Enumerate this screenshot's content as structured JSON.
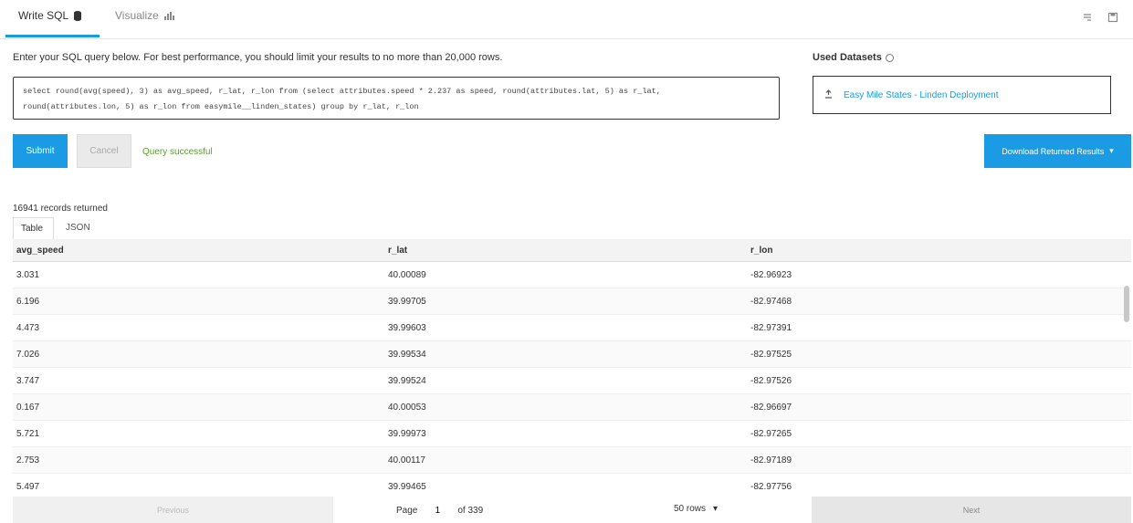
{
  "tabs": {
    "sql": "Write SQL",
    "visualize": "Visualize"
  },
  "instruction": "Enter your SQL query below. For best performance, you should limit your results to no more than 20,000 rows.",
  "sql": {
    "line1": "select round(avg(speed), 3) as avg_speed, r_lat, r_lon from (select attributes.speed * 2.237 as speed, round(attributes.lat, 5) as r_lat,",
    "line2": "round(attributes.lon, 5) as r_lon from easymile__linden_states) group by r_lat, r_lon"
  },
  "used_datasets": {
    "label": "Used Datasets",
    "items": [
      "Easy Mile States - Linden Deployment"
    ]
  },
  "buttons": {
    "submit": "Submit",
    "cancel": "Cancel",
    "download": "Download Returned Results",
    "download_caret": "▾"
  },
  "status": "Query successful",
  "records_text": "16941 records returned",
  "result_tabs": [
    "Table",
    "JSON"
  ],
  "columns": [
    "avg_speed",
    "r_lat",
    "r_lon"
  ],
  "rows": [
    [
      "3.031",
      "40.00089",
      "-82.96923"
    ],
    [
      "6.196",
      "39.99705",
      "-82.97468"
    ],
    [
      "4.473",
      "39.99603",
      "-82.97391"
    ],
    [
      "7.026",
      "39.99534",
      "-82.97525"
    ],
    [
      "3.747",
      "39.99524",
      "-82.97526"
    ],
    [
      "0.167",
      "40.00053",
      "-82.96697"
    ],
    [
      "5.721",
      "39.99973",
      "-82.97265"
    ],
    [
      "2.753",
      "40.00117",
      "-82.97189"
    ],
    [
      "5.497",
      "39.99465",
      "-82.97756"
    ]
  ],
  "pager": {
    "previous": "Previous",
    "page_label": "Page",
    "page": "1",
    "of": "of 339",
    "rows": "50 rows",
    "rows_caret": "▾",
    "next": "Next"
  },
  "colors": {
    "accent": "#1a9be3",
    "success": "#5a9e2d"
  }
}
